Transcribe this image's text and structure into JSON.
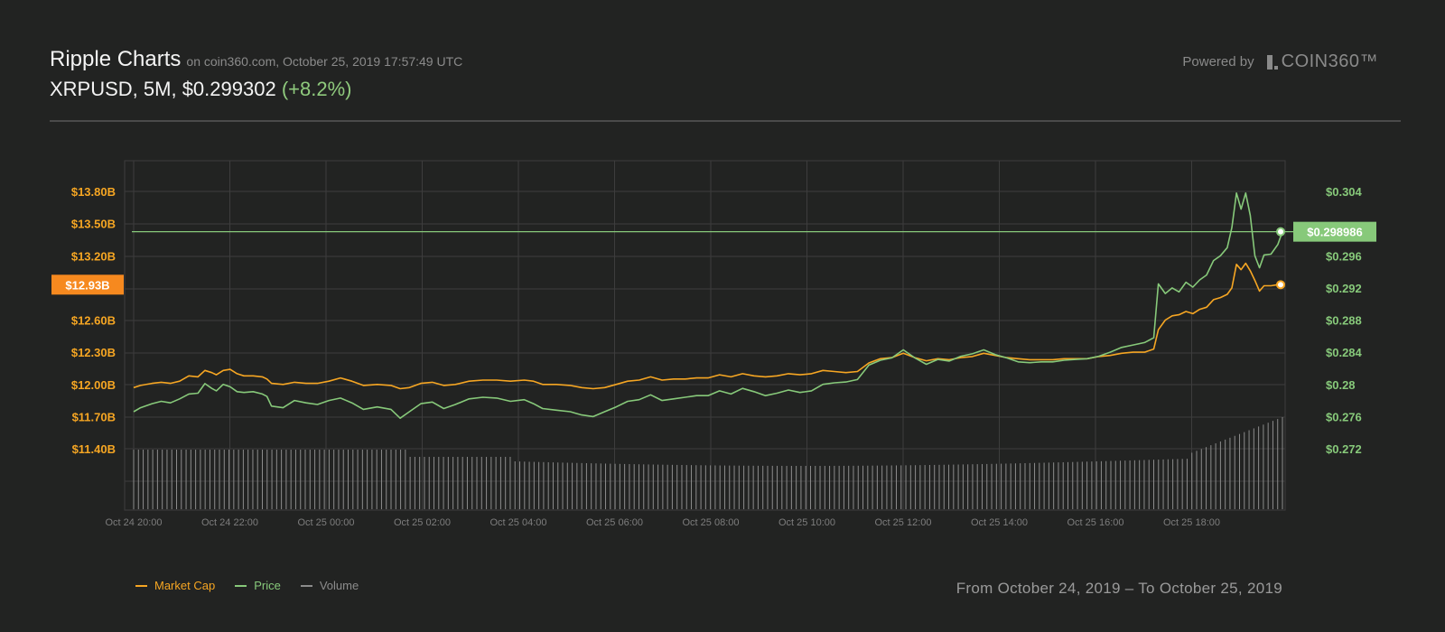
{
  "header": {
    "title": "Ripple Charts",
    "source": "on coin360.com, October 25, 2019 17:57:49 UTC",
    "ticker": "XRPUSD, 5M, $0.299302",
    "change": "(+8.2%)"
  },
  "powered": {
    "label": "Powered by",
    "logo_text": "COIN360™"
  },
  "chart_data": {
    "type": "line",
    "colors": {
      "market_cap": "#f6a623",
      "price": "#87c97a",
      "volume": "#8c8c8c",
      "grid": "#3d3d3d",
      "background": "#222322"
    },
    "x_ticks": [
      "Oct 24 20:00",
      "Oct 24 22:00",
      "Oct 25 00:00",
      "Oct 25 02:00",
      "Oct 25 04:00",
      "Oct 25 06:00",
      "Oct 25 08:00",
      "Oct 25 10:00",
      "Oct 25 12:00",
      "Oct 25 14:00",
      "Oct 25 16:00",
      "Oct 25 18:00"
    ],
    "x_range_hours": [
      0,
      24
    ],
    "left_axis": {
      "ticks": [
        "$13.80B",
        "$13.50B",
        "$13.20B",
        "$12.60B",
        "$12.30B",
        "$12.00B",
        "$11.70B",
        "$11.40B"
      ],
      "tick_values": [
        13.8,
        13.5,
        13.2,
        12.6,
        12.3,
        12.0,
        11.7,
        11.4
      ],
      "range": [
        11.4,
        13.8
      ],
      "current_label": "$12.93B",
      "current_value": 12.93
    },
    "right_axis": {
      "ticks": [
        "$0.304",
        "$0.296",
        "$0.292",
        "$0.288",
        "$0.284",
        "$0.28",
        "$0.276",
        "$0.272"
      ],
      "tick_values": [
        0.304,
        0.296,
        0.292,
        0.288,
        0.284,
        0.28,
        0.276,
        0.272
      ],
      "range": [
        0.272,
        0.304
      ],
      "current_label": "$0.298986",
      "current_value": 0.298986
    },
    "legend": [
      {
        "name": "Market Cap",
        "color": "#f6a623"
      },
      {
        "name": "Price",
        "color": "#87c97a"
      },
      {
        "name": "Volume",
        "color": "#8c8c8c"
      }
    ],
    "series": [
      {
        "name": "Market Cap",
        "axis": "left",
        "points": [
          [
            0,
            11.97
          ],
          [
            0.3,
            11.99
          ],
          [
            0.8,
            12.01
          ],
          [
            1.2,
            12.02
          ],
          [
            1.6,
            12.01
          ],
          [
            2.0,
            12.03
          ],
          [
            2.4,
            12.08
          ],
          [
            2.8,
            12.07
          ],
          [
            3.1,
            12.13
          ],
          [
            3.4,
            12.11
          ],
          [
            3.6,
            12.09
          ],
          [
            3.9,
            12.13
          ],
          [
            4.2,
            12.14
          ],
          [
            4.5,
            12.1
          ],
          [
            4.8,
            12.08
          ],
          [
            5.2,
            12.08
          ],
          [
            5.6,
            12.07
          ],
          [
            5.8,
            12.05
          ],
          [
            6.0,
            12.01
          ],
          [
            6.5,
            12.0
          ],
          [
            7.0,
            12.02
          ],
          [
            7.5,
            12.01
          ],
          [
            8.0,
            12.01
          ],
          [
            8.5,
            12.03
          ],
          [
            9.0,
            12.06
          ],
          [
            9.5,
            12.03
          ],
          [
            10.0,
            11.99
          ],
          [
            10.6,
            12.0
          ],
          [
            11.2,
            11.99
          ],
          [
            11.6,
            11.96
          ],
          [
            12.0,
            11.97
          ],
          [
            12.5,
            12.01
          ],
          [
            13.0,
            12.02
          ],
          [
            13.5,
            11.99
          ],
          [
            14.0,
            12.0
          ],
          [
            14.6,
            12.03
          ],
          [
            15.2,
            12.04
          ],
          [
            15.8,
            12.04
          ],
          [
            16.4,
            12.03
          ],
          [
            17.0,
            12.04
          ],
          [
            17.4,
            12.03
          ],
          [
            17.8,
            12.0
          ],
          [
            18.4,
            12.0
          ],
          [
            19.0,
            11.99
          ],
          [
            19.5,
            11.97
          ],
          [
            20.0,
            11.96
          ],
          [
            20.5,
            11.97
          ],
          [
            21.0,
            12.0
          ],
          [
            21.5,
            12.03
          ],
          [
            22.0,
            12.04
          ],
          [
            22.5,
            12.07
          ],
          [
            23.0,
            12.04
          ],
          [
            23.5,
            12.05
          ],
          [
            24.0,
            12.05
          ],
          [
            24.5,
            12.06
          ],
          [
            25.0,
            12.06
          ],
          [
            25.5,
            12.09
          ],
          [
            26.0,
            12.07
          ],
          [
            26.5,
            12.1
          ],
          [
            27.0,
            12.08
          ],
          [
            27.5,
            12.07
          ],
          [
            28.0,
            12.08
          ],
          [
            28.5,
            12.1
          ],
          [
            29.0,
            12.09
          ],
          [
            29.5,
            12.1
          ],
          [
            30.0,
            12.13
          ],
          [
            30.5,
            12.12
          ],
          [
            31.0,
            12.11
          ],
          [
            31.5,
            12.12
          ],
          [
            32.0,
            12.2
          ],
          [
            32.5,
            12.24
          ],
          [
            33.0,
            12.25
          ],
          [
            33.5,
            12.29
          ],
          [
            34.0,
            12.25
          ],
          [
            34.5,
            12.22
          ],
          [
            35.0,
            12.24
          ],
          [
            35.5,
            12.23
          ],
          [
            36.0,
            12.25
          ],
          [
            36.5,
            12.26
          ],
          [
            37.0,
            12.29
          ],
          [
            37.5,
            12.27
          ],
          [
            38.0,
            12.25
          ],
          [
            38.5,
            12.24
          ],
          [
            39.0,
            12.23
          ],
          [
            39.5,
            12.23
          ],
          [
            40.0,
            12.23
          ],
          [
            40.5,
            12.24
          ],
          [
            41.0,
            12.24
          ],
          [
            41.5,
            12.24
          ],
          [
            42.0,
            12.26
          ],
          [
            42.5,
            12.27
          ],
          [
            43.0,
            12.29
          ],
          [
            43.5,
            12.3
          ],
          [
            44.0,
            12.3
          ],
          [
            44.4,
            12.33
          ],
          [
            44.6,
            12.51
          ],
          [
            44.9,
            12.6
          ],
          [
            45.2,
            12.64
          ],
          [
            45.5,
            12.65
          ],
          [
            45.8,
            12.68
          ],
          [
            46.1,
            12.66
          ],
          [
            46.4,
            12.7
          ],
          [
            46.7,
            12.72
          ],
          [
            47.0,
            12.79
          ],
          [
            47.3,
            12.81
          ],
          [
            47.6,
            12.84
          ],
          [
            47.8,
            12.9
          ],
          [
            48.0,
            13.12
          ],
          [
            48.2,
            13.07
          ],
          [
            48.4,
            13.13
          ],
          [
            48.6,
            13.06
          ],
          [
            48.8,
            12.97
          ],
          [
            49.0,
            12.87
          ],
          [
            49.2,
            12.92
          ],
          [
            49.5,
            12.92
          ],
          [
            49.8,
            12.93
          ],
          [
            50.0,
            12.94
          ]
        ]
      },
      {
        "name": "Price",
        "axis": "right",
        "points": [
          [
            0,
            0.2766
          ],
          [
            0.3,
            0.2771
          ],
          [
            0.8,
            0.2776
          ],
          [
            1.2,
            0.2779
          ],
          [
            1.6,
            0.2777
          ],
          [
            2.0,
            0.2782
          ],
          [
            2.4,
            0.2788
          ],
          [
            2.8,
            0.2789
          ],
          [
            3.1,
            0.2801
          ],
          [
            3.4,
            0.2795
          ],
          [
            3.6,
            0.2792
          ],
          [
            3.9,
            0.28
          ],
          [
            4.2,
            0.2797
          ],
          [
            4.5,
            0.2791
          ],
          [
            4.8,
            0.279
          ],
          [
            5.2,
            0.2791
          ],
          [
            5.6,
            0.2788
          ],
          [
            5.8,
            0.2785
          ],
          [
            6.0,
            0.2773
          ],
          [
            6.5,
            0.2771
          ],
          [
            7.0,
            0.278
          ],
          [
            7.5,
            0.2777
          ],
          [
            8.0,
            0.2775
          ],
          [
            8.5,
            0.278
          ],
          [
            9.0,
            0.2783
          ],
          [
            9.5,
            0.2777
          ],
          [
            10.0,
            0.2769
          ],
          [
            10.6,
            0.2772
          ],
          [
            11.2,
            0.2769
          ],
          [
            11.6,
            0.2758
          ],
          [
            12.0,
            0.2766
          ],
          [
            12.5,
            0.2776
          ],
          [
            13.0,
            0.2778
          ],
          [
            13.5,
            0.277
          ],
          [
            14.0,
            0.2775
          ],
          [
            14.6,
            0.2782
          ],
          [
            15.2,
            0.2784
          ],
          [
            15.8,
            0.2783
          ],
          [
            16.4,
            0.2779
          ],
          [
            17.0,
            0.2781
          ],
          [
            17.4,
            0.2776
          ],
          [
            17.8,
            0.277
          ],
          [
            18.4,
            0.2768
          ],
          [
            19.0,
            0.2766
          ],
          [
            19.5,
            0.2762
          ],
          [
            20.0,
            0.276
          ],
          [
            20.5,
            0.2766
          ],
          [
            21.0,
            0.2772
          ],
          [
            21.5,
            0.2779
          ],
          [
            22.0,
            0.2781
          ],
          [
            22.5,
            0.2787
          ],
          [
            23.0,
            0.278
          ],
          [
            23.5,
            0.2782
          ],
          [
            24.0,
            0.2784
          ],
          [
            24.5,
            0.2786
          ],
          [
            25.0,
            0.2786
          ],
          [
            25.5,
            0.2792
          ],
          [
            26.0,
            0.2788
          ],
          [
            26.5,
            0.2795
          ],
          [
            27.0,
            0.2791
          ],
          [
            27.5,
            0.2786
          ],
          [
            28.0,
            0.2789
          ],
          [
            28.5,
            0.2793
          ],
          [
            29.0,
            0.279
          ],
          [
            29.5,
            0.2792
          ],
          [
            30.0,
            0.28
          ],
          [
            30.5,
            0.2802
          ],
          [
            31.0,
            0.2803
          ],
          [
            31.5,
            0.2806
          ],
          [
            32.0,
            0.2824
          ],
          [
            32.5,
            0.283
          ],
          [
            33.0,
            0.2833
          ],
          [
            33.5,
            0.2843
          ],
          [
            34.0,
            0.2833
          ],
          [
            34.5,
            0.2825
          ],
          [
            35.0,
            0.2831
          ],
          [
            35.5,
            0.2829
          ],
          [
            36.0,
            0.2835
          ],
          [
            36.5,
            0.2838
          ],
          [
            37.0,
            0.2843
          ],
          [
            37.5,
            0.2837
          ],
          [
            38.0,
            0.2833
          ],
          [
            38.5,
            0.2828
          ],
          [
            39.0,
            0.2827
          ],
          [
            39.5,
            0.2828
          ],
          [
            40.0,
            0.2828
          ],
          [
            40.5,
            0.283
          ],
          [
            41.0,
            0.2831
          ],
          [
            41.5,
            0.2832
          ],
          [
            42.0,
            0.2835
          ],
          [
            42.5,
            0.284
          ],
          [
            43.0,
            0.2846
          ],
          [
            43.5,
            0.2849
          ],
          [
            44.0,
            0.2852
          ],
          [
            44.4,
            0.2858
          ],
          [
            44.6,
            0.2925
          ],
          [
            44.9,
            0.2913
          ],
          [
            45.2,
            0.292
          ],
          [
            45.5,
            0.2915
          ],
          [
            45.8,
            0.2927
          ],
          [
            46.1,
            0.2921
          ],
          [
            46.4,
            0.293
          ],
          [
            46.7,
            0.2936
          ],
          [
            47.0,
            0.2954
          ],
          [
            47.3,
            0.296
          ],
          [
            47.6,
            0.297
          ],
          [
            47.8,
            0.2995
          ],
          [
            48.0,
            0.3038
          ],
          [
            48.2,
            0.3018
          ],
          [
            48.4,
            0.3038
          ],
          [
            48.6,
            0.301
          ],
          [
            48.8,
            0.296
          ],
          [
            49.0,
            0.2945
          ],
          [
            49.2,
            0.2961
          ],
          [
            49.5,
            0.2962
          ],
          [
            49.8,
            0.2974
          ],
          [
            50.0,
            0.299
          ]
        ]
      }
    ],
    "volume": {
      "baseline_level": 0.92,
      "end_level": 1.0
    }
  },
  "legend": {
    "market_cap": "Market Cap",
    "price": "Price",
    "volume": "Volume"
  },
  "date_range": "From October 24, 2019 – To October 25, 2019"
}
